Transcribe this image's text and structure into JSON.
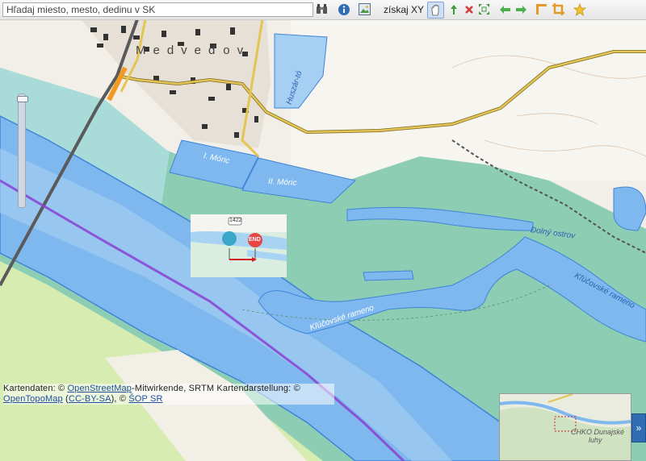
{
  "toolbar": {
    "search_placeholder": "Hľadaj miesto, mesto, dedinu v SK",
    "get_xy_label": "získaj XY",
    "icons": [
      "binoculars-icon",
      "info-icon",
      "image-icon",
      "pan-hand-icon",
      "zoom-in-icon",
      "zoom-out-icon",
      "zoom-extent-icon",
      "back-arrow-icon",
      "forward-arrow-icon",
      "measure-icon",
      "crop-icon",
      "favorite-star-icon"
    ]
  },
  "map": {
    "place_labels": {
      "village": "Medveďov",
      "pond": "Huszár-tó",
      "lake1": "I. Móric",
      "lake2": "II. Móric",
      "island": "Dolný ostrov",
      "arm1": "Kľúčovské rameno",
      "arm2": "Kľúčovské rameno",
      "road_number": "1422"
    },
    "route_preview": {
      "end_label": "END",
      "road_number": "1422"
    },
    "overview": {
      "label_line1": "CHKO Dunajské",
      "label_line2": "luhy"
    },
    "overview_toggle": "»"
  },
  "attribution": {
    "prefix": "Kartendaten: © ",
    "osm_link": "OpenStreetMap",
    "mid": "-Mitwirkende, SRTM Kartendarstellung: © ",
    "otm_link": "OpenTopoMap",
    "paren_open": " (",
    "license_link": "CC-BY-SA",
    "paren_close": "), © ",
    "sop_link": "ŠOP SR"
  },
  "colors": {
    "river": "#7fb8ee",
    "water_edge": "#3f84d8",
    "floodplain": "#8ccdb4",
    "protected_fill": "#a9dcd9",
    "meadow": "#d6ecb0",
    "road": "#e4c452",
    "bridge": "#f39a22",
    "border": "#8a3fd1"
  }
}
